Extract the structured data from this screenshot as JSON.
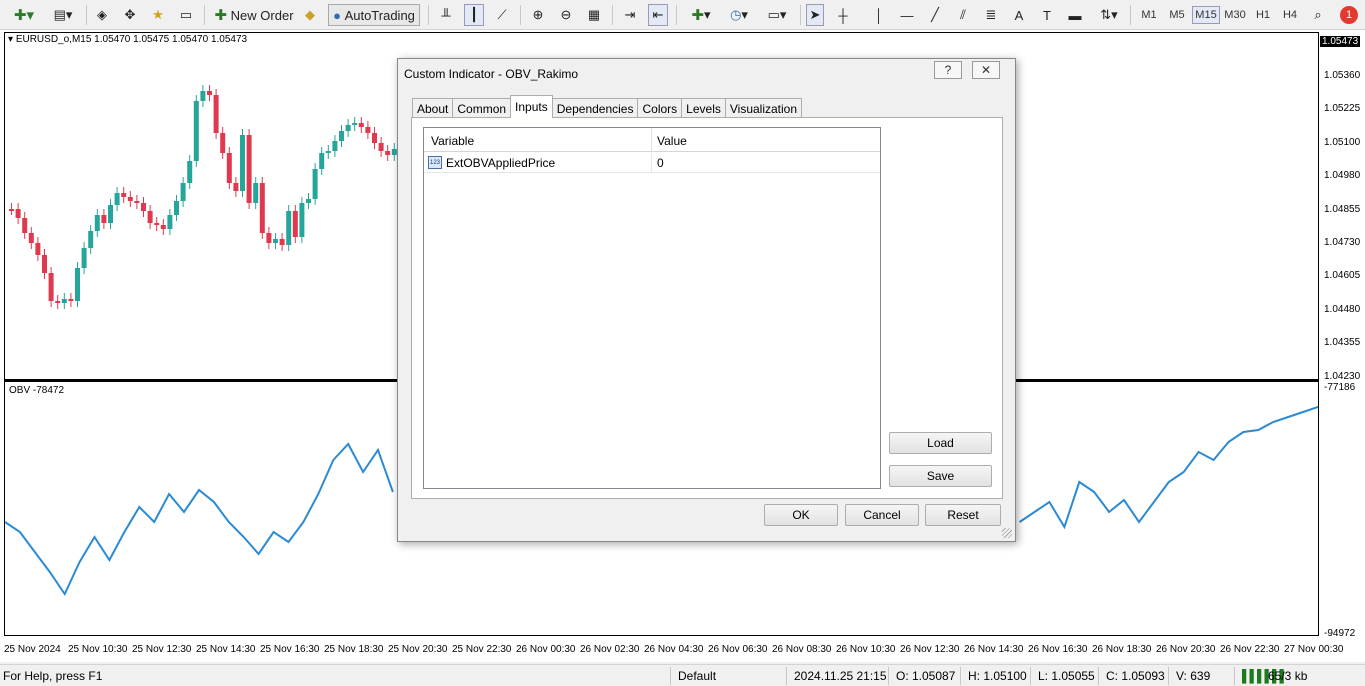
{
  "toolbar": {
    "new_order": "New Order",
    "autotrading": "AutoTrading",
    "timeframes": [
      "M1",
      "M5",
      "M15",
      "M30",
      "H1",
      "H4"
    ],
    "active_timeframe": "M15",
    "alert_count": "1"
  },
  "chart": {
    "symbol_line": "EURUSD_o,M15  1.05470 1.05475 1.05470 1.05473",
    "current_price": "1.05473",
    "price_scale": [
      "1.05360",
      "1.05225",
      "1.05100",
      "1.04980",
      "1.04855",
      "1.04730",
      "1.04605",
      "1.04480",
      "1.04355",
      "1.04230"
    ],
    "indicator_title": "OBV -78472",
    "indicator_scale_top": "-77186",
    "indicator_scale_bottom": "-94972",
    "time_labels": [
      "25 Nov 2024",
      "25 Nov 10:30",
      "25 Nov 12:30",
      "25 Nov 14:30",
      "25 Nov 16:30",
      "25 Nov 18:30",
      "25 Nov 20:30",
      "25 Nov 22:30",
      "26 Nov 00:30",
      "26 Nov 02:30",
      "26 Nov 04:30",
      "26 Nov 06:30",
      "26 Nov 08:30",
      "26 Nov 10:30",
      "26 Nov 12:30",
      "26 Nov 14:30",
      "26 Nov 16:30",
      "26 Nov 18:30",
      "26 Nov 20:30",
      "26 Nov 22:30",
      "27 Nov 00:30"
    ],
    "colors": {
      "bull": "#26a69a",
      "bear": "#e0394f",
      "obv_line": "#2a8ad4"
    }
  },
  "dialog": {
    "title": "Custom Indicator - OBV_Rakimo",
    "help_label": "?",
    "close_label": "✕",
    "tabs": [
      "About",
      "Common",
      "Inputs",
      "Dependencies",
      "Colors",
      "Levels",
      "Visualization"
    ],
    "active_tab": "Inputs",
    "grid": {
      "col_variable": "Variable",
      "col_value": "Value",
      "rows": [
        {
          "icon": "123",
          "variable": "ExtOBVAppliedPrice",
          "value": "0"
        }
      ]
    },
    "load_label": "Load",
    "save_label": "Save",
    "ok_label": "OK",
    "cancel_label": "Cancel",
    "reset_label": "Reset"
  },
  "status": {
    "help": "For Help, press F1",
    "profile": "Default",
    "datetime": "2024.11.25 21:15",
    "open": "O: 1.05087",
    "high": "H: 1.05100",
    "low": "L: 1.05055",
    "close": "C: 1.05093",
    "volume": "V: 639",
    "traffic": "65/3 kb"
  }
}
